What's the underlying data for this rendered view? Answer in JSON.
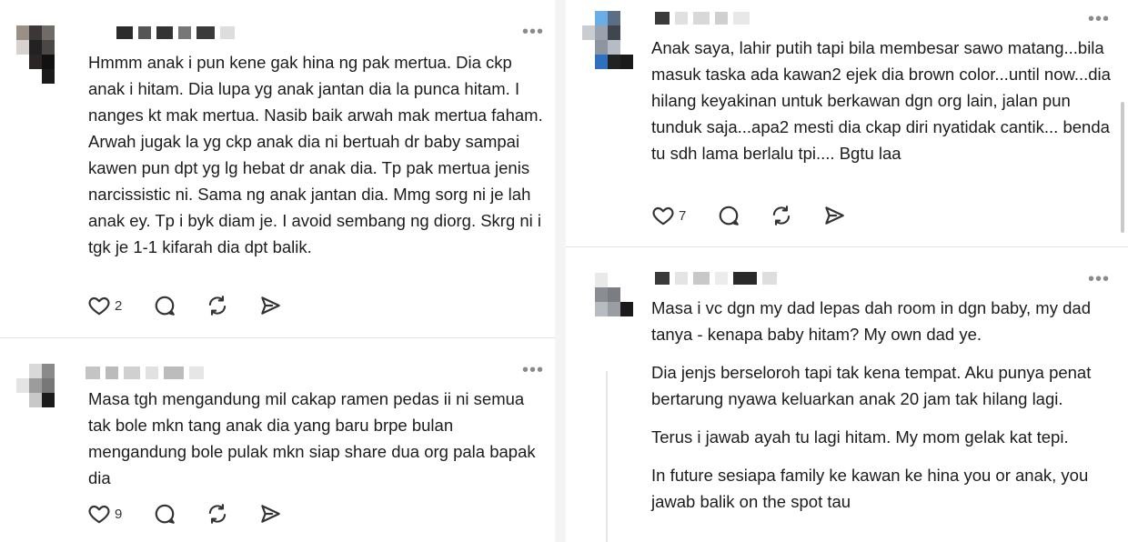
{
  "colors": {
    "text": "#1c1c1c",
    "icon": "#333333",
    "divider": "#e3e3e3",
    "gutter": "#f4f4f4"
  },
  "icons": {
    "like": "heart-icon",
    "comment": "comment-bubble-icon",
    "repost": "repost-icon",
    "share": "send-icon",
    "more": "more-dots-icon"
  },
  "posts": [
    {
      "paragraphs": [
        "Hmmm anak i pun kene gak hina ng pak mertua. Dia ckp anak i hitam. Dia lupa yg anak jantan dia la punca hitam. I nanges kt mak mertua. Nasib baik arwah mak mertua faham. Arwah jugak la yg ckp anak dia ni bertuah dr baby sampai kawen pun dpt yg lg hebat dr anak dia. Tp pak mertua jenis narcissistic ni. Sama ng anak jantan dia. Mmg sorg ni je lah anak ey. Tp i byk diam je. I avoid sembang ng diorg. Skrg ni i tgk je 1-1 kifarah dia dpt balik."
      ],
      "likes": "2",
      "more": "•••"
    },
    {
      "paragraphs": [
        "Masa tgh mengandung mil cakap ramen pedas ii ni semua tak bole mkn tang anak dia yang baru brpe bulan mengandung bole pulak mkn siap share dua org pala bapak dia"
      ],
      "likes": "9",
      "more": "•••"
    },
    {
      "paragraphs": [
        "Anak saya, lahir putih tapi bila membesar sawo matang...bila masuk taska ada kawan2 ejek dia brown color...until now...dia hilang keyakinan untuk berkawan dgn org lain, jalan pun tunduk saja...apa2 mesti dia ckap diri nyatidak cantik... benda tu sdh lama berlalu tpi.... Bgtu laa"
      ],
      "likes": "7",
      "more": "•••"
    },
    {
      "paragraphs": [
        "Masa i vc dgn my dad lepas dah room in dgn baby, my dad tanya - kenapa baby hitam? My own dad ye.",
        "Dia jenjs berseloroh tapi tak kena tempat. Aku punya penat bertarung nyawa keluarkan anak 20 jam tak hilang lagi.",
        "Terus i jawab ayah tu lagi hitam. My mom gelak kat tepi.",
        "In future sesiapa family ke kawan ke hina you or anak, you jawab balik on the spot tau"
      ],
      "more": "•••"
    }
  ]
}
